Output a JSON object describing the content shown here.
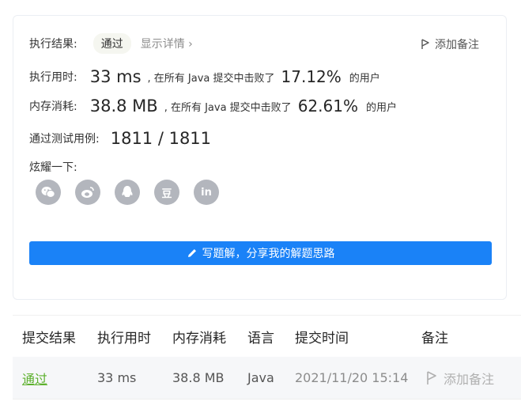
{
  "result": {
    "label": "执行结果:",
    "status": "通过",
    "detail_link": "显示详情 ›",
    "add_note": "添加备注"
  },
  "runtime": {
    "label": "执行用时:",
    "value": "33 ms",
    "text": ", 在所有 Java 提交中击败了",
    "percent": "17.12%",
    "suffix": "的用户"
  },
  "memory": {
    "label": "内存消耗:",
    "value": "38.8 MB",
    "text": ", 在所有 Java 提交中击败了",
    "percent": "62.61%",
    "suffix": "的用户"
  },
  "testcases": {
    "label": "通过测试用例:",
    "value": "1811 / 1811"
  },
  "share": {
    "label": "炫耀一下:",
    "icons": [
      "wechat-icon",
      "weibo-icon",
      "qq-icon",
      "douban-icon",
      "linkedin-icon"
    ],
    "douban_glyph": "豆",
    "linkedin_glyph": "in"
  },
  "write_solution": "写题解，分享我的解题思路",
  "table": {
    "headers": [
      "提交结果",
      "执行用时",
      "内存消耗",
      "语言",
      "提交时间",
      "备注"
    ],
    "row": {
      "result": "通过",
      "runtime": "33 ms",
      "memory": "38.8 MB",
      "language": "Java",
      "time": "2021/11/20 15:14",
      "note": "添加备注"
    }
  },
  "colors": {
    "accent": "#1a82f7",
    "pass_green": "#5cb02c",
    "share_icon_gray": "#b3b6bd"
  }
}
